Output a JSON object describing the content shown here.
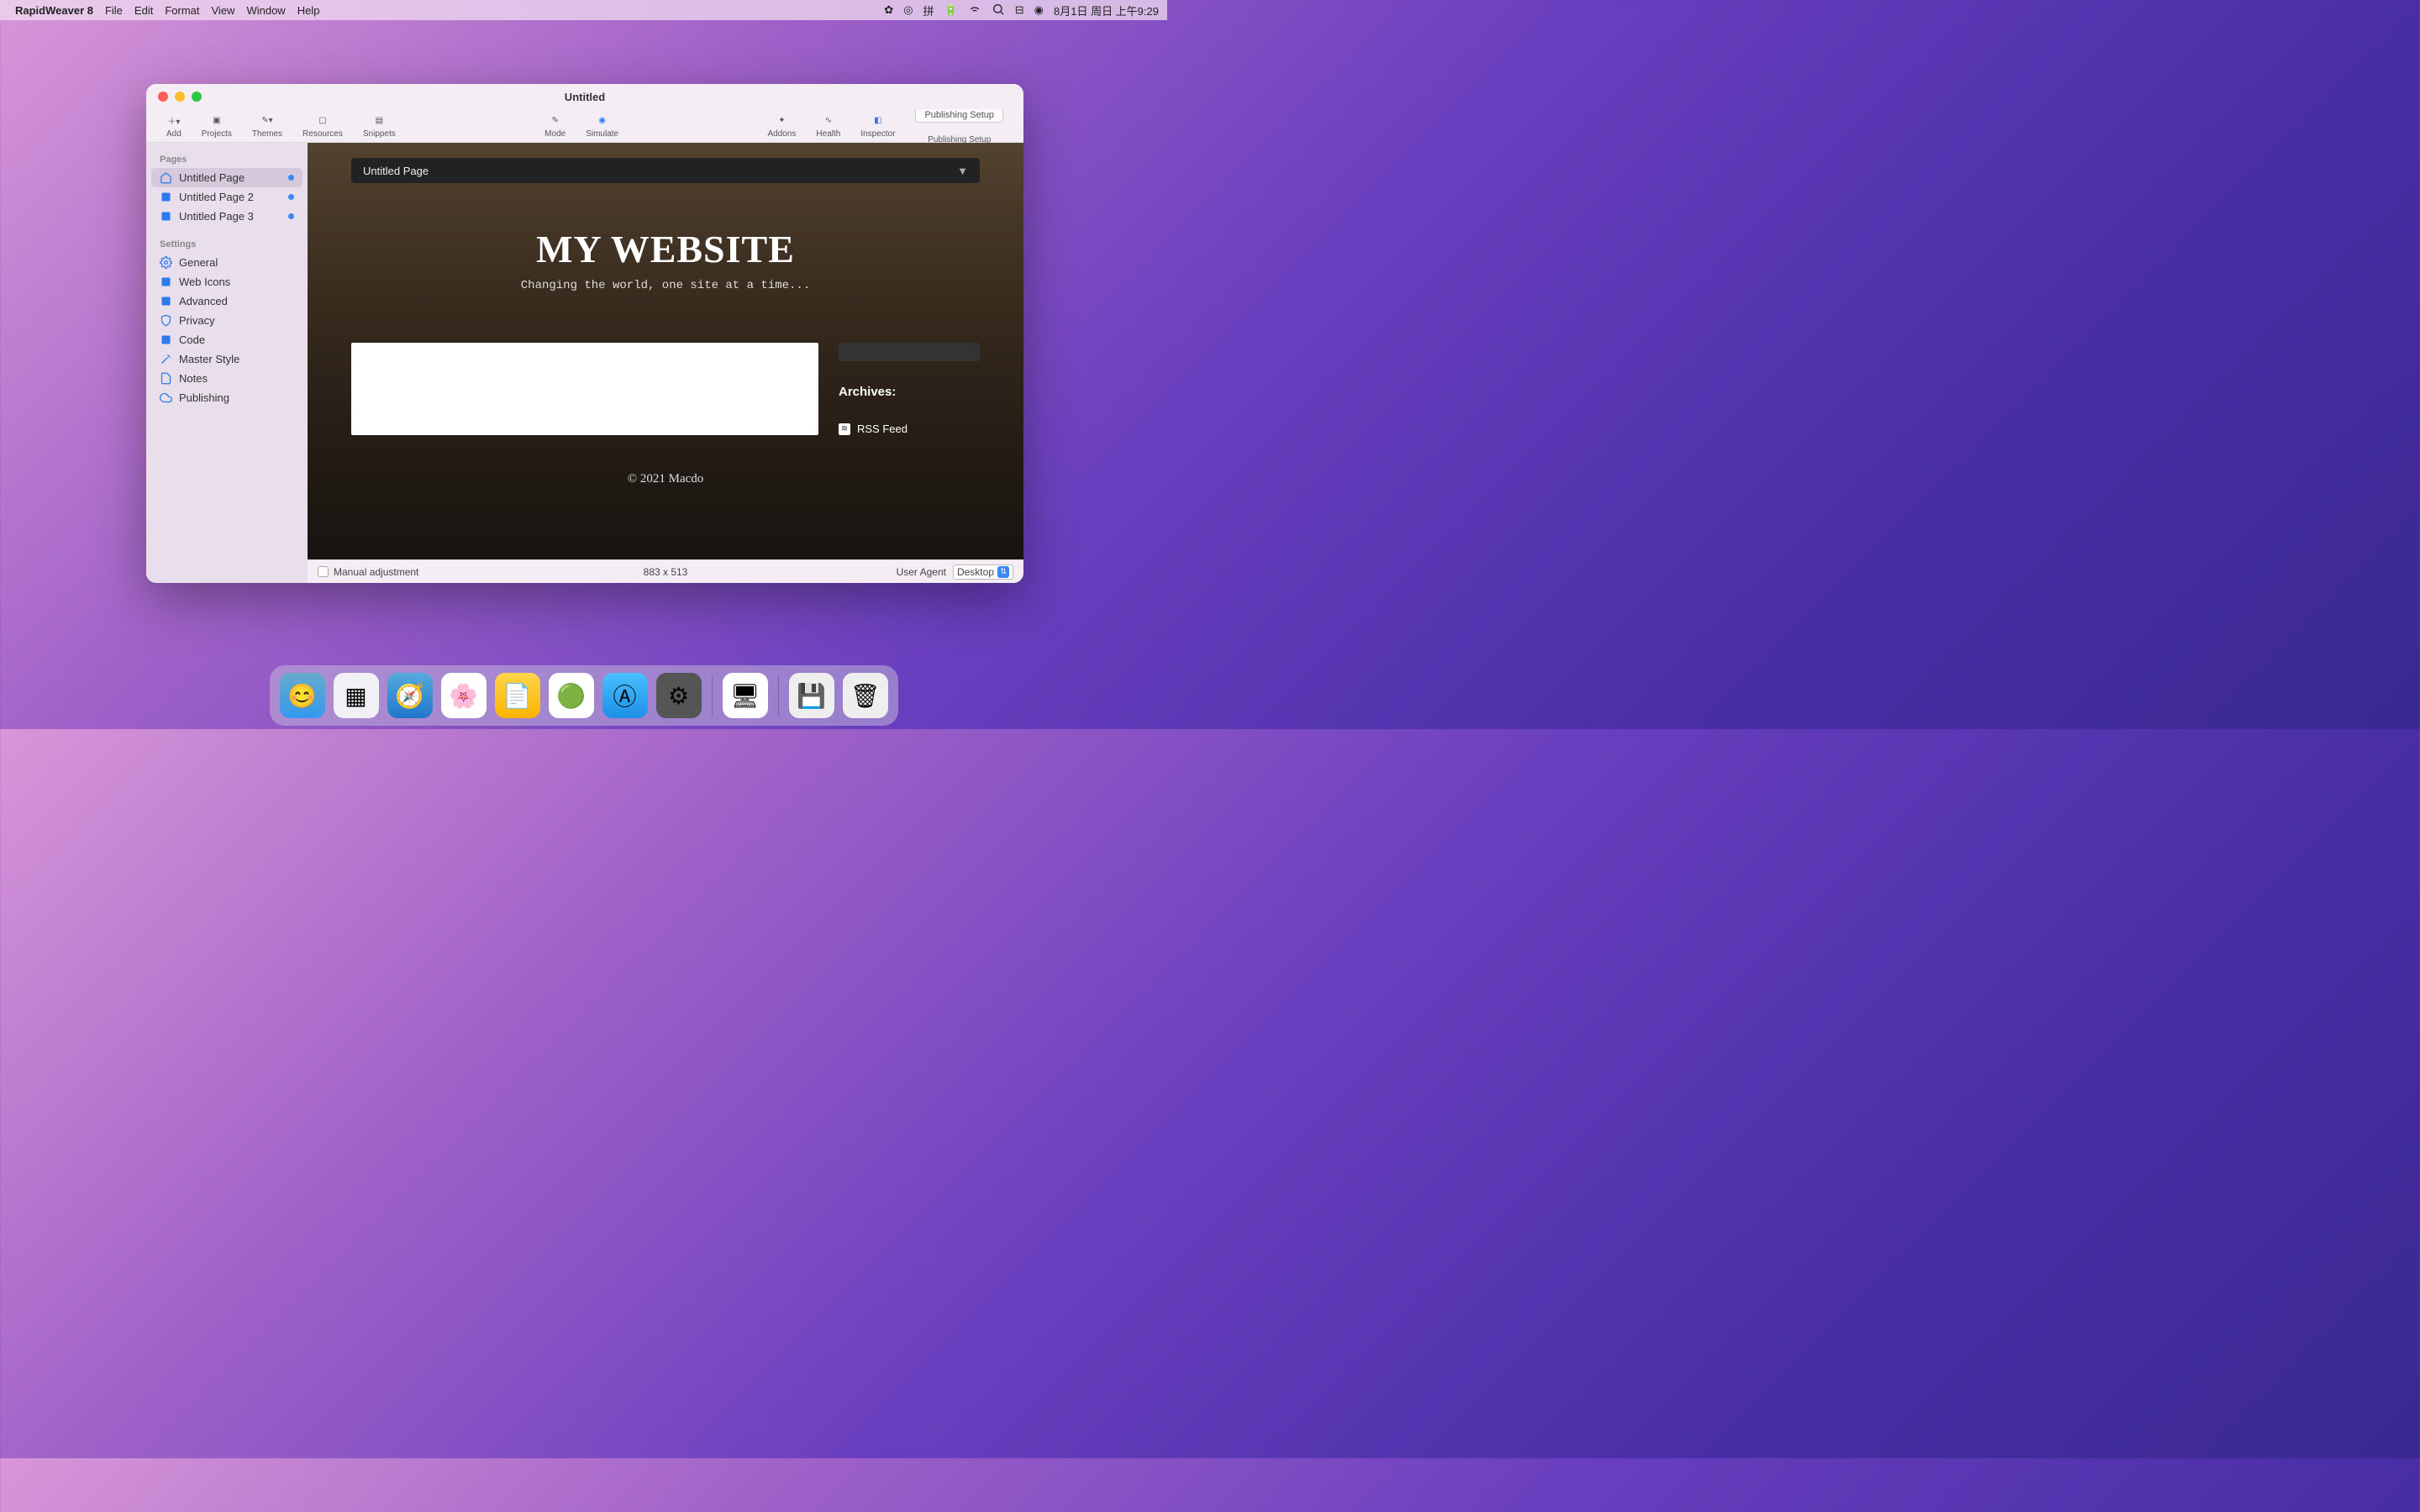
{
  "menubar": {
    "app": "RapidWeaver 8",
    "items": [
      "File",
      "Edit",
      "Format",
      "View",
      "Window",
      "Help"
    ],
    "clock": "8月1日 周日 上午9:29"
  },
  "window": {
    "title": "Untitled"
  },
  "toolbar": {
    "add": "Add",
    "projects": "Projects",
    "themes": "Themes",
    "resources": "Resources",
    "snippets": "Snippets",
    "mode": "Mode",
    "simulate": "Simulate",
    "addons": "Addons",
    "health": "Health",
    "inspector": "Inspector",
    "pubsetup": "Publishing Setup",
    "pubsetup2": "Publishing Setup"
  },
  "sidebar": {
    "pages_head": "Pages",
    "pages": [
      {
        "label": "Untitled Page"
      },
      {
        "label": "Untitled Page 2"
      },
      {
        "label": "Untitled Page 3"
      }
    ],
    "settings_head": "Settings",
    "settings": [
      {
        "label": "General"
      },
      {
        "label": "Web Icons"
      },
      {
        "label": "Advanced"
      },
      {
        "label": "Privacy"
      },
      {
        "label": "Code"
      },
      {
        "label": "Master Style"
      },
      {
        "label": "Notes"
      },
      {
        "label": "Publishing"
      }
    ]
  },
  "preview": {
    "pagebar": "Untitled Page",
    "hero_title": "MY WEBSITE",
    "hero_sub": "Changing the world, one site at a time...",
    "archives": "Archives:",
    "rss": "RSS Feed",
    "footer": "© 2021 Macdo"
  },
  "status": {
    "manual": "Manual adjustment",
    "dims": "883 x 513",
    "ua": "User Agent",
    "device": "Desktop"
  }
}
